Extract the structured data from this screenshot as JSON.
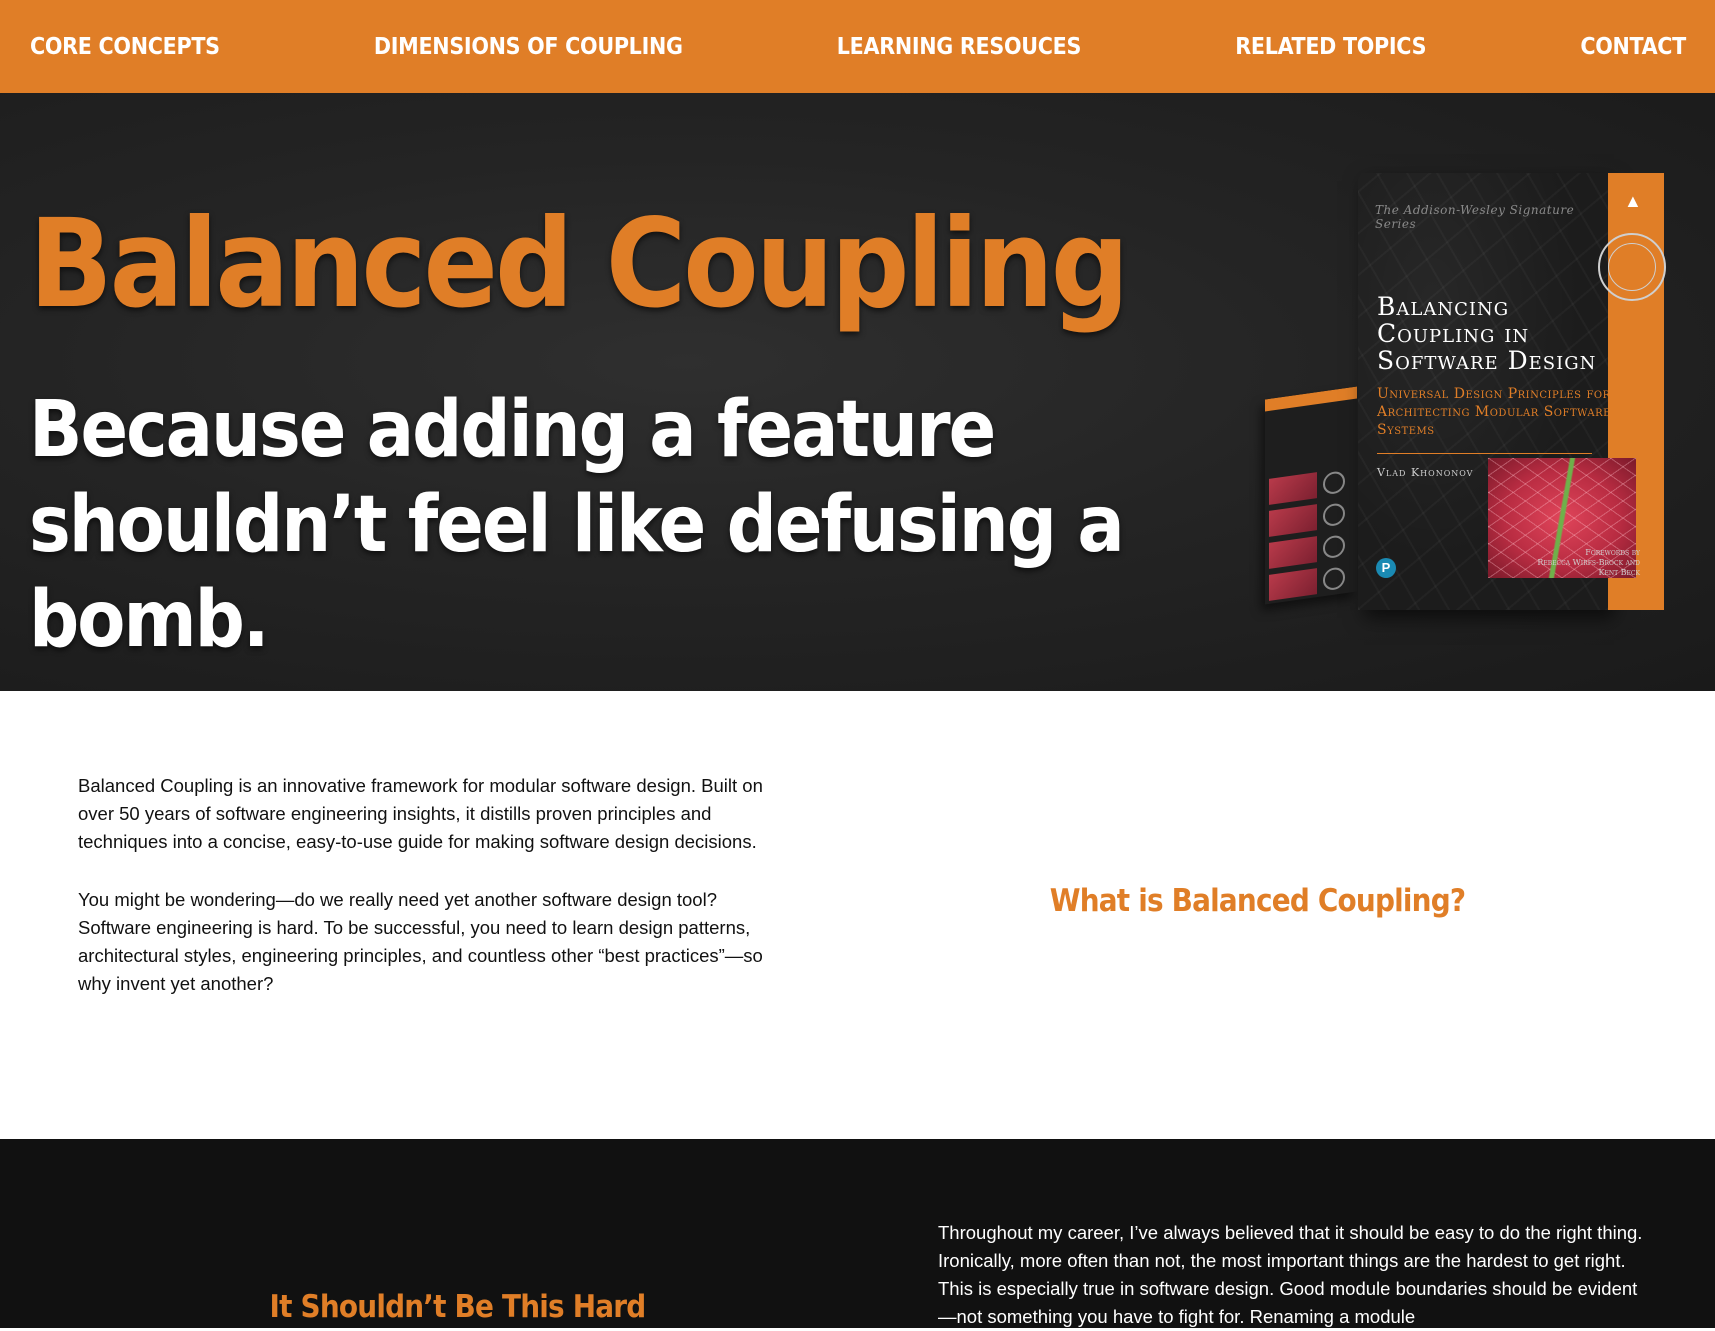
{
  "nav": {
    "items": [
      {
        "label": "CORE CONCEPTS"
      },
      {
        "label": "DIMENSIONS OF COUPLING"
      },
      {
        "label": "LEARNING RESOUCES"
      },
      {
        "label": "RELATED TOPICS"
      },
      {
        "label": "CONTACT"
      }
    ]
  },
  "hero": {
    "title": "Balanced Coupling",
    "subtitle": "Because adding a feature shouldn’t feel like defusing a bomb."
  },
  "book": {
    "series": "The Addison-Wesley Signature Series",
    "title": "Balancing Coupling in Software Design",
    "subtitle": "Universal Design Principles for Architecting Modular Software Systems",
    "author": "Vlad Khononov",
    "forewords_label": "Forewords by",
    "forewords_names": "Rebecca Wirfs-Brock and Kent Beck",
    "publisher_logo": "P",
    "imprint_icon": "mountain-icon"
  },
  "intro": {
    "paragraph1": "Balanced Coupling is an innovative framework for modular software design. Built on over 50 years of software engineering insights, it distills proven principles and techniques into a concise, easy-to-use guide for making software design decisions.",
    "paragraph2": "You might be wondering—do we really need yet another software design tool? Software engineering is hard. To be successful, you need to learn design patterns, architectural styles, engineering principles, and countless other “best practices”—so why invent yet another?",
    "heading": "What is Balanced Coupling?"
  },
  "hard": {
    "heading": "It Shouldn’t Be This Hard",
    "paragraph": "Throughout my career, I’ve always believed that it should be easy to do the right thing. Ironically, more often than not, the most important things are the hardest to get right. This is especially true in software design. Good module boundaries should be evident—not something you have to fight for. Renaming a module"
  },
  "colors": {
    "accent": "#E07E27",
    "hero_background": "#242424",
    "dark_section": "#111111",
    "text": "#111111"
  }
}
